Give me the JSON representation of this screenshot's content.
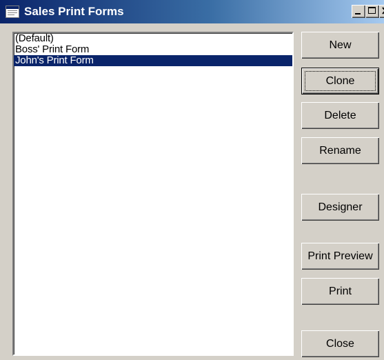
{
  "window": {
    "title": "Sales Print Forms",
    "app_icon": "window-icon",
    "controls": [
      "minimize-icon",
      "maximize-icon",
      "close-icon"
    ]
  },
  "forms_list": {
    "items": [
      {
        "label": "(Default)",
        "selected": false
      },
      {
        "label": "Boss' Print Form",
        "selected": false
      },
      {
        "label": "John's Print Form",
        "selected": true
      }
    ]
  },
  "buttons": {
    "new": "New",
    "clone": "Clone",
    "delete": "Delete",
    "rename": "Rename",
    "designer": "Designer",
    "print_preview": "Print Preview",
    "print": "Print",
    "close": "Close"
  },
  "colors": {
    "title_bar": "#0a246a",
    "selection": "#0a246a",
    "face": "#d4d0c8"
  }
}
